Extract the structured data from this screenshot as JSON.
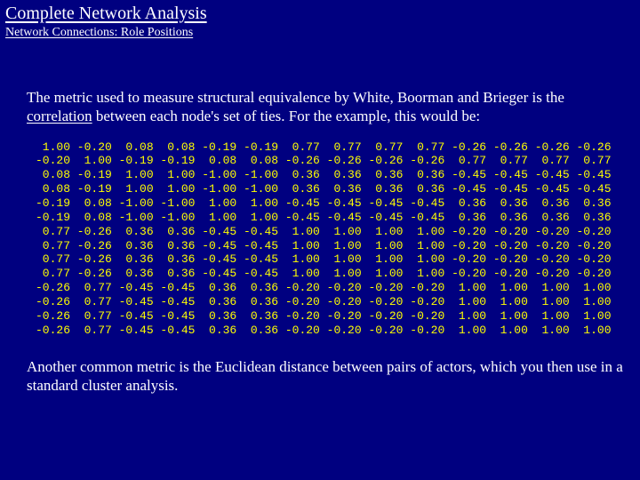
{
  "header": {
    "title": "Complete Network Analysis",
    "subtitle": "Network Connections: Role Positions"
  },
  "body": {
    "para1_a": "The metric used to measure structural equivalence by White, Boorman and Brieger is the ",
    "para1_u": "correlation",
    "para1_b": " between each node's set of ties.  For the example, this would be:",
    "para2": "Another common metric is the Euclidean distance between pairs of actors, which you then use in a standard cluster analysis."
  },
  "chart_data": {
    "type": "table",
    "title": "Correlation matrix of node ties",
    "rows": 14,
    "cols": 14,
    "values": [
      [
        1.0,
        -0.2,
        0.08,
        0.08,
        -0.19,
        -0.19,
        0.77,
        0.77,
        0.77,
        0.77,
        -0.26,
        -0.26,
        -0.26,
        -0.26
      ],
      [
        -0.2,
        1.0,
        -0.19,
        -0.19,
        0.08,
        0.08,
        -0.26,
        -0.26,
        -0.26,
        -0.26,
        0.77,
        0.77,
        0.77,
        0.77
      ],
      [
        0.08,
        -0.19,
        1.0,
        1.0,
        -1.0,
        -1.0,
        0.36,
        0.36,
        0.36,
        0.36,
        -0.45,
        -0.45,
        -0.45,
        -0.45
      ],
      [
        0.08,
        -0.19,
        1.0,
        1.0,
        -1.0,
        -1.0,
        0.36,
        0.36,
        0.36,
        0.36,
        -0.45,
        -0.45,
        -0.45,
        -0.45
      ],
      [
        -0.19,
        0.08,
        -1.0,
        -1.0,
        1.0,
        1.0,
        -0.45,
        -0.45,
        -0.45,
        -0.45,
        0.36,
        0.36,
        0.36,
        0.36
      ],
      [
        -0.19,
        0.08,
        -1.0,
        -1.0,
        1.0,
        1.0,
        -0.45,
        -0.45,
        -0.45,
        -0.45,
        0.36,
        0.36,
        0.36,
        0.36
      ],
      [
        0.77,
        -0.26,
        0.36,
        0.36,
        -0.45,
        -0.45,
        1.0,
        1.0,
        1.0,
        1.0,
        -0.2,
        -0.2,
        -0.2,
        -0.2
      ],
      [
        0.77,
        -0.26,
        0.36,
        0.36,
        -0.45,
        -0.45,
        1.0,
        1.0,
        1.0,
        1.0,
        -0.2,
        -0.2,
        -0.2,
        -0.2
      ],
      [
        0.77,
        -0.26,
        0.36,
        0.36,
        -0.45,
        -0.45,
        1.0,
        1.0,
        1.0,
        1.0,
        -0.2,
        -0.2,
        -0.2,
        -0.2
      ],
      [
        0.77,
        -0.26,
        0.36,
        0.36,
        -0.45,
        -0.45,
        1.0,
        1.0,
        1.0,
        1.0,
        -0.2,
        -0.2,
        -0.2,
        -0.2
      ],
      [
        -0.26,
        0.77,
        -0.45,
        -0.45,
        0.36,
        0.36,
        -0.2,
        -0.2,
        -0.2,
        -0.2,
        1.0,
        1.0,
        1.0,
        1.0
      ],
      [
        -0.26,
        0.77,
        -0.45,
        -0.45,
        0.36,
        0.36,
        -0.2,
        -0.2,
        -0.2,
        -0.2,
        1.0,
        1.0,
        1.0,
        1.0
      ],
      [
        -0.26,
        0.77,
        -0.45,
        -0.45,
        0.36,
        0.36,
        -0.2,
        -0.2,
        -0.2,
        -0.2,
        1.0,
        1.0,
        1.0,
        1.0
      ],
      [
        -0.26,
        0.77,
        -0.45,
        -0.45,
        0.36,
        0.36,
        -0.2,
        -0.2,
        -0.2,
        -0.2,
        1.0,
        1.0,
        1.0,
        1.0
      ]
    ]
  }
}
